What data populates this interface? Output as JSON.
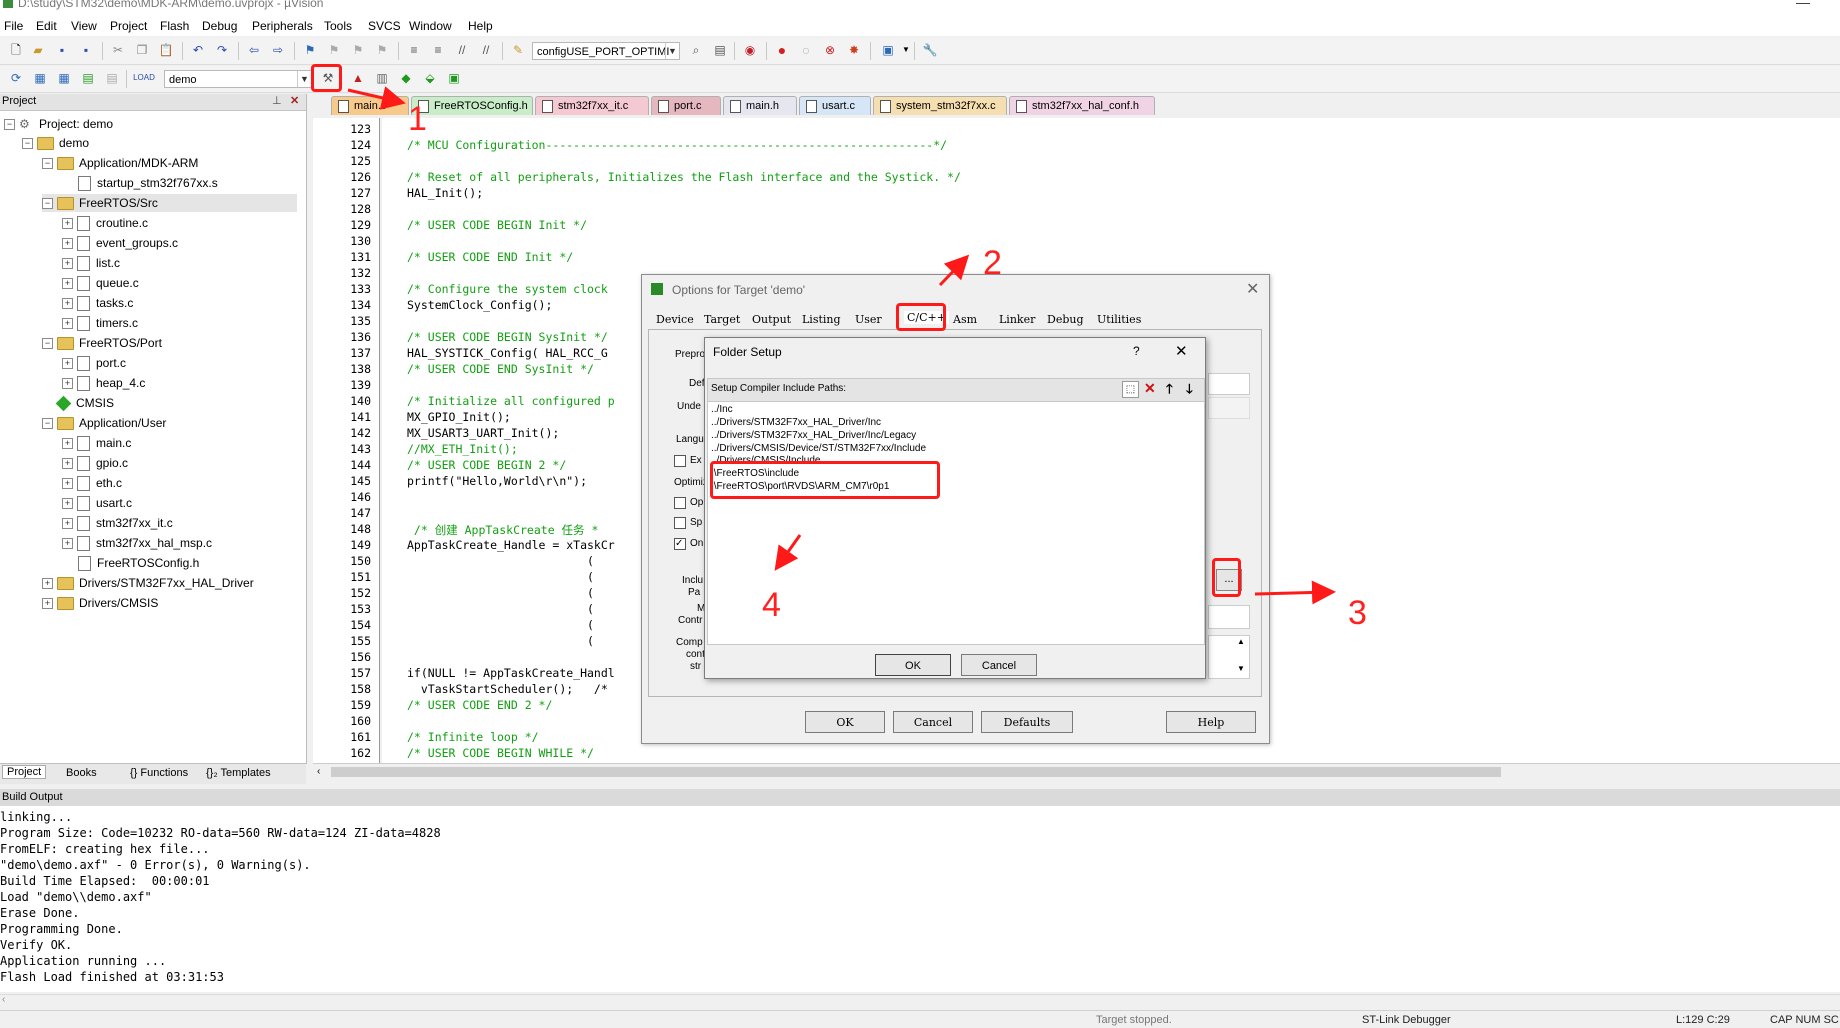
{
  "window": {
    "title": "D:\\study\\STM32\\demo\\MDK-ARM\\demo.uvprojx - µVision"
  },
  "menu": [
    "File",
    "Edit",
    "View",
    "Project",
    "Flash",
    "Debug",
    "Peripherals",
    "Tools",
    "SVCS",
    "Window",
    "Help"
  ],
  "toolbar": {
    "find_combo": "configUSE_PORT_OPTIMI",
    "target_combo": "demo"
  },
  "project": {
    "header": "Project",
    "root": "Project: demo",
    "target": "demo",
    "groups": [
      {
        "name": "Application/MDK-ARM",
        "files": [
          "startup_stm32f767xx.s"
        ]
      },
      {
        "name": "FreeRTOS/Src",
        "files": [
          "croutine.c",
          "event_groups.c",
          "list.c",
          "queue.c",
          "tasks.c",
          "timers.c"
        ]
      },
      {
        "name": "FreeRTOS/Port",
        "files": [
          "port.c",
          "heap_4.c"
        ]
      },
      {
        "name": "CMSIS",
        "files": []
      },
      {
        "name": "Application/User",
        "files": [
          "main.c",
          "gpio.c",
          "eth.c",
          "usart.c",
          "stm32f7xx_it.c",
          "stm32f7xx_hal_msp.c",
          "FreeRTOSConfig.h"
        ]
      },
      {
        "name": "Drivers/STM32F7xx_HAL_Driver",
        "files": []
      },
      {
        "name": "Drivers/CMSIS",
        "files": []
      }
    ],
    "bottom_tabs": [
      "Project",
      "Books",
      "{} Functions",
      "{}₂ Templates"
    ]
  },
  "editor": {
    "tabs": [
      "main.c",
      "FreeRTOSConfig.h",
      "stm32f7xx_it.c",
      "port.c",
      "main.h",
      "usart.c",
      "system_stm32f7xx.c",
      "stm32f7xx_hal_conf.h"
    ],
    "line_numbers": [
      "123",
      "124",
      "125",
      "126",
      "127",
      "128",
      "129",
      "130",
      "131",
      "132",
      "133",
      "134",
      "135",
      "136",
      "137",
      "138",
      "139",
      "140",
      "141",
      "142",
      "143",
      "144",
      "145",
      "146",
      "147",
      "148",
      "149",
      "150",
      "151",
      "152",
      "153",
      "154",
      "155",
      "156",
      "157",
      "158",
      "159",
      "160",
      "161",
      "162"
    ],
    "lines": [
      {
        "t": "",
        "c": false
      },
      {
        "t": "/* MCU Configuration--------------------------------------------------------*/",
        "c": true
      },
      {
        "t": "",
        "c": false
      },
      {
        "t": "/* Reset of all peripherals, Initializes the Flash interface and the Systick. */",
        "c": true
      },
      {
        "t": "HAL_Init();",
        "c": false
      },
      {
        "t": "",
        "c": false
      },
      {
        "t": "/* USER CODE BEGIN Init */",
        "c": true
      },
      {
        "t": "",
        "c": false
      },
      {
        "t": "/* USER CODE END Init */",
        "c": true
      },
      {
        "t": "",
        "c": false
      },
      {
        "t": "/* Configure the system clock",
        "c": true
      },
      {
        "t": "SystemClock_Config();",
        "c": false
      },
      {
        "t": "",
        "c": false
      },
      {
        "t": "/* USER CODE BEGIN SysInit */",
        "c": true
      },
      {
        "t": "HAL_SYSTICK_Config( HAL_RCC_G",
        "c": false
      },
      {
        "t": "/* USER CODE END SysInit */",
        "c": true
      },
      {
        "t": "",
        "c": false
      },
      {
        "t": "/* Initialize all configured p",
        "c": true
      },
      {
        "t": "MX_GPIO_Init();",
        "c": false
      },
      {
        "t": "MX_USART3_UART_Init();",
        "c": false
      },
      {
        "t": "//MX_ETH_Init();",
        "c": true
      },
      {
        "t": "/* USER CODE BEGIN 2 */",
        "c": true
      },
      {
        "t": "printf(\"Hello,World\\r\\n\");",
        "c": false
      },
      {
        "t": "",
        "c": false
      },
      {
        "t": "",
        "c": false
      },
      {
        "t": " /* 创建 AppTaskCreate 任务 *",
        "c": true
      },
      {
        "t": "AppTaskCreate_Handle = xTaskCr",
        "c": false
      },
      {
        "t": "                          (",
        "c": false
      },
      {
        "t": "                          (",
        "c": false
      },
      {
        "t": "                          (",
        "c": false
      },
      {
        "t": "                          (",
        "c": false
      },
      {
        "t": "                          (",
        "c": false
      },
      {
        "t": "                          (",
        "c": false
      },
      {
        "t": "",
        "c": false
      },
      {
        "t": "if(NULL != AppTaskCreate_Handl",
        "c": false
      },
      {
        "t": "  vTaskStartScheduler();   /*",
        "c": false
      },
      {
        "t": "/* USER CODE END 2 */",
        "c": true
      },
      {
        "t": "",
        "c": false
      },
      {
        "t": "/* Infinite loop */",
        "c": true
      },
      {
        "t": "/* USER CODE BEGIN WHILE */",
        "c": true
      }
    ]
  },
  "build": {
    "header": "Build Output",
    "lines": [
      "linking...",
      "Program Size: Code=10232 RO-data=560 RW-data=124 ZI-data=4828",
      "FromELF: creating hex file...",
      "\"demo\\demo.axf\" - 0 Error(s), 0 Warning(s).",
      "Build Time Elapsed:  00:00:01",
      "Load \"demo\\\\demo.axf\"",
      "Erase Done.",
      "Programming Done.",
      "Verify OK.",
      "Application running ...",
      "Flash Load finished at 03:31:53"
    ]
  },
  "status": {
    "state": "Target stopped.",
    "debugger": "ST-Link Debugger",
    "position": "L:129 C:29",
    "caps": "CAP  NUM  SC"
  },
  "options_dialog": {
    "title": "Options for Target 'demo'",
    "tabs": [
      "Device",
      "Target",
      "Output",
      "Listing",
      "User",
      "C/C++",
      "Asm",
      "Linker",
      "Debug",
      "Utilities"
    ],
    "partial_labels": [
      "Prepro",
      "Def",
      "Unde",
      "Langu",
      "Ex",
      "Optimiz",
      "Op",
      "Sp",
      "On",
      "Inclu",
      "Pa",
      "M",
      "Contr",
      "Comp",
      "cont",
      "str"
    ],
    "buttons": {
      "ok": "OK",
      "cancel": "Cancel",
      "defaults": "Defaults",
      "help": "Help"
    },
    "browse": "..."
  },
  "folder_dialog": {
    "title": "Folder Setup",
    "help": "?",
    "label": "Setup Compiler Include Paths:",
    "paths": [
      "../Inc",
      "../Drivers/STM32F7xx_HAL_Driver/Inc",
      "../Drivers/STM32F7xx_HAL_Driver/Inc/Legacy",
      "../Drivers/CMSIS/Device/ST/STM32F7xx/Include",
      "../Drivers/CMSIS/Include",
      ".\\FreeRTOS\\include",
      ".\\FreeRTOS\\port\\RVDS\\ARM_CM7\\r0p1"
    ],
    "ok": "OK",
    "cancel": "Cancel"
  },
  "annotations": {
    "step1": "1",
    "step2": "2",
    "step3": "3",
    "step4": "4",
    "color": "#ff1a1a"
  }
}
